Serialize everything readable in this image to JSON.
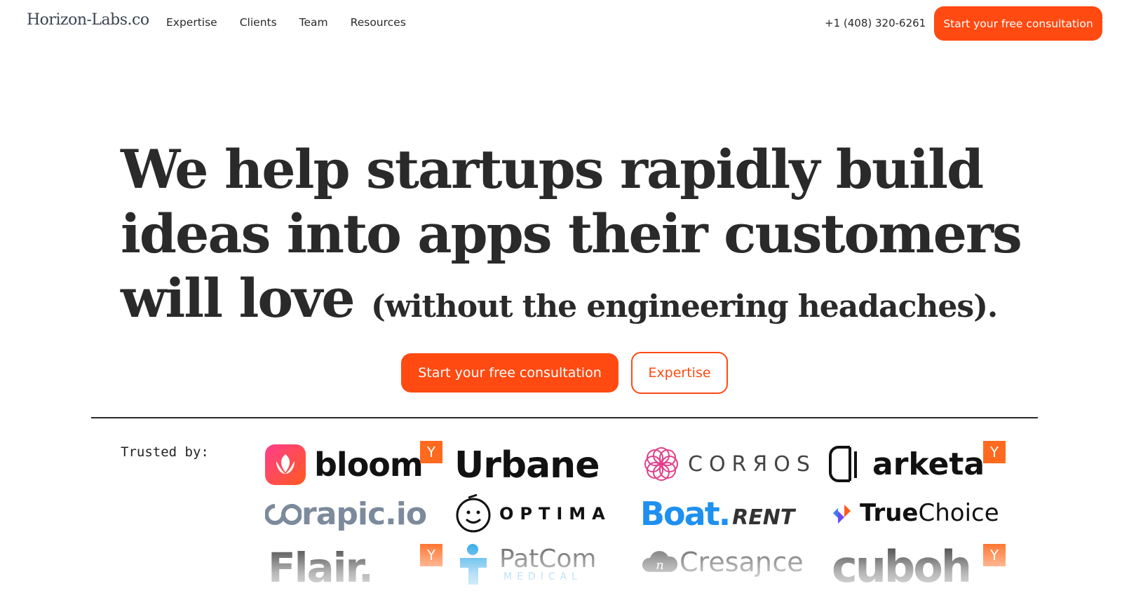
{
  "nav": {
    "brand": "Horizon-Labs.co",
    "links": [
      "Expertise",
      "Clients",
      "Team",
      "Resources"
    ],
    "phone": "+1 (408) 320-6261",
    "cta": "Start your free consultation"
  },
  "hero": {
    "line1": "We help startups rapidly build",
    "line2": "ideas into apps their customers",
    "line3": "will love",
    "line3_small": "(without the engineering headaches).",
    "cta_primary": "Start your free consultation",
    "cta_secondary": "Expertise"
  },
  "trusted": {
    "label": "Trusted by:",
    "yc_badge": "Y",
    "logos": {
      "bloom": "bloom",
      "urbane": "Urbane",
      "corros": "CORЯOS",
      "arketa": "arketa",
      "rapic": "rapic.io",
      "optima": "OPTIMA",
      "boat_main": "Boat.",
      "boat_rent": "RENT",
      "truechoice_a": "True",
      "truechoice_b": "Choice",
      "flair": "Flair.",
      "patcom": "PatCom",
      "patcom_sub": "MEDICAL",
      "cresance": "Cresaɲce",
      "cuboh": "cuboh"
    }
  },
  "colors": {
    "accent": "#ff4a12",
    "yc": "#ff6a1f",
    "text": "#2a2a2a",
    "boat_blue": "#1e90f0"
  }
}
